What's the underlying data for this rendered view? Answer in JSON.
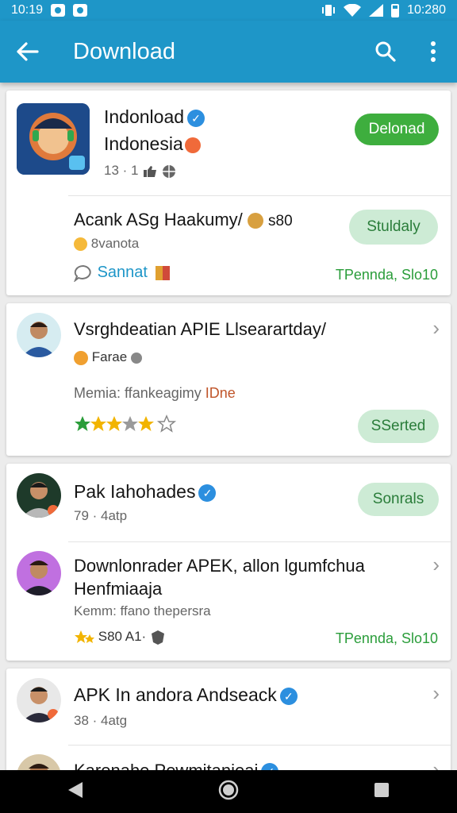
{
  "status_bar": {
    "time": "10:19",
    "right_time": "10:280"
  },
  "app_bar": {
    "title": "Download"
  },
  "card1": {
    "app_title_line1": "Indonload",
    "app_title_line2": "Indonesia",
    "meta": "13 · 1",
    "action_label": "Delonad",
    "sub_title": "Acank ASg Haakumy/",
    "sub_count": "s80",
    "sub_author": "8vanota",
    "sub_action_label": "Stuldaly",
    "comment_label": "Sannat",
    "footer_right": "TPennda, Slo10"
  },
  "card2": {
    "title": "Vsrghdeatian APIE Llsearartday/",
    "name": "Farae",
    "desc_prefix": "Memia: ffankeagimy",
    "desc_suffix": "IDne",
    "rating_stars": 4,
    "action_label": "SSerted"
  },
  "card3": {
    "item1": {
      "title": "Pak Iahohades",
      "meta": "79 · 4atp",
      "action_label": "Sonrals"
    },
    "item2": {
      "title_line1": "Downlonrader APEK, allon lgumfchua",
      "title_line2": "Henfmiaaja",
      "desc": "Kemm: ffano thepersra",
      "rating_text": "S80 A1·",
      "footer_right": "TPennda, Slo10"
    }
  },
  "card4": {
    "item1": {
      "title": "APK In andora Andseack",
      "meta": "38 · 4atg"
    },
    "item2": {
      "title": "Karonahe Pewmitanieai"
    }
  },
  "colors": {
    "primary": "#1e96c8",
    "success": "#3eae3e",
    "success_soft": "#cdebd5",
    "success_text": "#2a9d3a",
    "verify": "#2c8fdf",
    "star": "#f2b400"
  },
  "icons": [
    "arrow-back-icon",
    "search-icon",
    "more-vert-icon",
    "verified-icon",
    "chevron-right-icon",
    "star-icon",
    "comment-icon",
    "back-nav-icon",
    "home-nav-icon",
    "recents-nav-icon"
  ]
}
